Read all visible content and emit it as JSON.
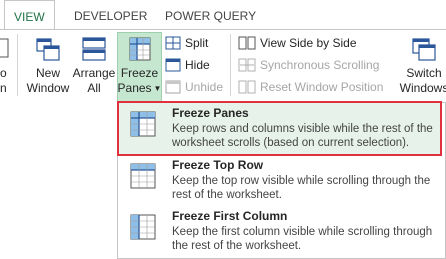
{
  "tabs": [
    "VIEW",
    "DEVELOPER",
    "POWER QUERY"
  ],
  "ribbon": {
    "left_partial": [
      "o",
      "n"
    ],
    "new_window": [
      "New",
      "Window"
    ],
    "arrange_all": [
      "Arrange",
      "All"
    ],
    "freeze_panes": [
      "Freeze",
      "Panes"
    ],
    "split": "Split",
    "hide": "Hide",
    "unhide": "Unhide",
    "view_side_by_side": "View Side by Side",
    "sync_scrolling": "Synchronous Scrolling",
    "reset_window": "Reset Window Position",
    "switch_windows": [
      "Switch",
      "Windows"
    ]
  },
  "menu": {
    "items": [
      {
        "title": "Freeze Panes",
        "desc": "Keep rows and columns visible while the rest of the worksheet scrolls (based on current selection)."
      },
      {
        "title": "Freeze Top Row",
        "desc": "Keep the top row visible while scrolling through the rest of the worksheet."
      },
      {
        "title": "Freeze First Column",
        "desc": "Keep the first column visible while scrolling through the rest of the worksheet."
      }
    ]
  },
  "colors": {
    "accent": "#217346",
    "highlight_border": "#e0303b",
    "pressed_bg": "#c5e6cf"
  }
}
